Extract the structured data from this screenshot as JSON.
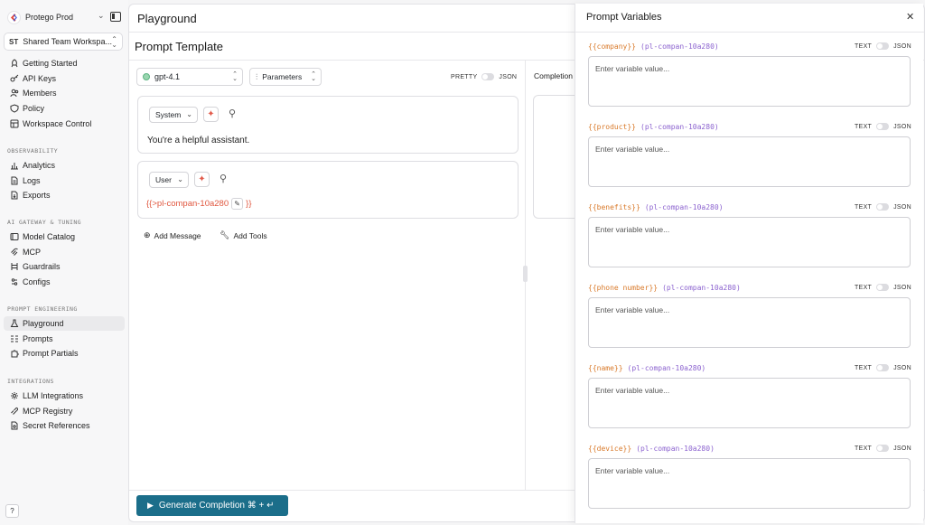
{
  "sidebar": {
    "org_name": "Protego Prod",
    "workspace_badge": "ST",
    "workspace_name": "Shared Team Workspa...",
    "main_items": [
      {
        "label": "Getting Started",
        "icon": "rocket-icon"
      },
      {
        "label": "API Keys",
        "icon": "key-icon"
      },
      {
        "label": "Members",
        "icon": "users-icon"
      },
      {
        "label": "Policy",
        "icon": "shield-icon"
      },
      {
        "label": "Workspace Control",
        "icon": "grid-icon"
      }
    ],
    "sections": [
      {
        "title": "OBSERVABILITY",
        "items": [
          {
            "label": "Analytics",
            "icon": "bar-chart-icon"
          },
          {
            "label": "Logs",
            "icon": "file-text-icon"
          },
          {
            "label": "Exports",
            "icon": "export-icon"
          }
        ]
      },
      {
        "title": "AI GATEWAY & TUNING",
        "items": [
          {
            "label": "Model Catalog",
            "icon": "catalog-icon"
          },
          {
            "label": "MCP",
            "icon": "mcp-icon"
          },
          {
            "label": "Guardrails",
            "icon": "guardrails-icon"
          },
          {
            "label": "Configs",
            "icon": "config-icon"
          }
        ]
      },
      {
        "title": "PROMPT ENGINEERING",
        "items": [
          {
            "label": "Playground",
            "icon": "flask-icon",
            "active": true
          },
          {
            "label": "Prompts",
            "icon": "prompts-icon"
          },
          {
            "label": "Prompt Partials",
            "icon": "puzzle-icon"
          }
        ]
      },
      {
        "title": "INTEGRATIONS",
        "items": [
          {
            "label": "LLM Integrations",
            "icon": "gear-icon"
          },
          {
            "label": "MCP Registry",
            "icon": "registry-icon"
          },
          {
            "label": "Secret References",
            "icon": "secret-icon"
          }
        ]
      }
    ],
    "help_label": "?"
  },
  "main": {
    "page_title": "Playground",
    "template_title": "Prompt Template",
    "model": "gpt-4.1",
    "parameters_label": "Parameters",
    "format_left": "PRETTY",
    "format_right": "JSON",
    "messages": [
      {
        "role": "System",
        "text": "You're a helpful assistant."
      },
      {
        "role": "User",
        "var_open": "{{>",
        "var_name": "pl-compan-10a280",
        "var_close": "}}"
      }
    ],
    "add_message_label": "Add Message",
    "add_tools_label": "Add Tools",
    "completion_label": "Completion",
    "generate_label": "Generate Completion ⌘ + ↵"
  },
  "drawer": {
    "title": "Prompt Variables",
    "toggle_left": "TEXT",
    "toggle_right": "JSON",
    "placeholder": "Enter variable value...",
    "variables": [
      {
        "open": "{{",
        "name": "company",
        "close": "}}",
        "source": "(pl-compan-10a280)"
      },
      {
        "open": "{{",
        "name": "product",
        "close": "}}",
        "source": "(pl-compan-10a280)"
      },
      {
        "open": "{{",
        "name": "benefits",
        "close": "}}",
        "source": "(pl-compan-10a280)"
      },
      {
        "open": "{{",
        "name": "phone number",
        "close": "}}",
        "source": "(pl-compan-10a280)"
      },
      {
        "open": "{{",
        "name": "name",
        "close": "}}",
        "source": "(pl-compan-10a280)"
      },
      {
        "open": "{{",
        "name": "device",
        "close": "}}",
        "source": "(pl-compan-10a280)"
      }
    ]
  },
  "colors": {
    "accent": "#1b6e8a",
    "variable_name": "#d97a2b",
    "variable_source": "#8b62cf",
    "variable_chip": "#e0573f"
  }
}
